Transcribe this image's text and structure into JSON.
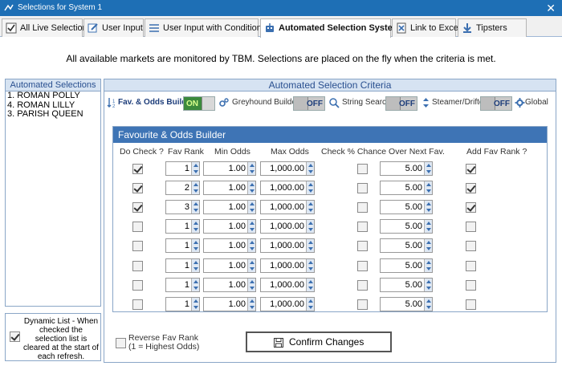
{
  "window": {
    "title": "Selections for System 1",
    "close_glyph": "✕"
  },
  "tabs": [
    {
      "label": "All Live Selections",
      "icon": "checkbox-icon"
    },
    {
      "label": "User Input",
      "icon": "edit-icon"
    },
    {
      "label": "User Input with Conditions",
      "icon": "list-icon"
    },
    {
      "label": "Automated Selection Systems",
      "icon": "robot-icon",
      "active": true
    },
    {
      "label": "Link to Excel",
      "icon": "excel-icon"
    },
    {
      "label": "Tipsters",
      "icon": "download-icon"
    }
  ],
  "banner": "All available markets are monitored by TBM. Selections are placed on the fly when the criteria is met.",
  "left_panel": {
    "title": "Automated Selections",
    "items": [
      "1. ROMAN POLLY",
      "4. ROMAN LILLY",
      "3. PARISH QUEEN"
    ]
  },
  "dynamic_list": {
    "label": "Dynamic List - When checked the selection list is cleared at the start of each refresh.",
    "checked": true
  },
  "criteria": {
    "title": "Automated Selection Criteria",
    "toolbar": [
      {
        "label": "Fav. & Odds Builder",
        "state": "ON"
      },
      {
        "label": "Greyhound Builder",
        "state": "OFF"
      },
      {
        "label": "String Search",
        "state": "OFF"
      },
      {
        "label": "Steamer/Drifter",
        "state": "OFF"
      },
      {
        "label": "Global"
      }
    ]
  },
  "builder": {
    "title": "Favourite & Odds Builder",
    "columns": {
      "do_check": "Do Check ?",
      "fav_rank": "Fav Rank",
      "min_odds": "Min Odds",
      "max_odds": "Max Odds",
      "check_pct": "Check % Chance Over Next Fav.",
      "add_fav_rank": "Add Fav Rank ?"
    },
    "rows": [
      {
        "do_check": true,
        "fav_rank": "1",
        "min_odds": "1.00",
        "max_odds": "1,000.00",
        "check_pct": false,
        "pct": "5.00",
        "add_fav_rank": true
      },
      {
        "do_check": true,
        "fav_rank": "2",
        "min_odds": "1.00",
        "max_odds": "1,000.00",
        "check_pct": false,
        "pct": "5.00",
        "add_fav_rank": true
      },
      {
        "do_check": true,
        "fav_rank": "3",
        "min_odds": "1.00",
        "max_odds": "1,000.00",
        "check_pct": false,
        "pct": "5.00",
        "add_fav_rank": true
      },
      {
        "do_check": false,
        "fav_rank": "1",
        "min_odds": "1.00",
        "max_odds": "1,000.00",
        "check_pct": false,
        "pct": "5.00",
        "add_fav_rank": false
      },
      {
        "do_check": false,
        "fav_rank": "1",
        "min_odds": "1.00",
        "max_odds": "1,000.00",
        "check_pct": false,
        "pct": "5.00",
        "add_fav_rank": false
      },
      {
        "do_check": false,
        "fav_rank": "1",
        "min_odds": "1.00",
        "max_odds": "1,000.00",
        "check_pct": false,
        "pct": "5.00",
        "add_fav_rank": false
      },
      {
        "do_check": false,
        "fav_rank": "1",
        "min_odds": "1.00",
        "max_odds": "1,000.00",
        "check_pct": false,
        "pct": "5.00",
        "add_fav_rank": false
      },
      {
        "do_check": false,
        "fav_rank": "1",
        "min_odds": "1.00",
        "max_odds": "1,000.00",
        "check_pct": false,
        "pct": "5.00",
        "add_fav_rank": false
      }
    ]
  },
  "reverse_fav": {
    "line1": "Reverse Fav Rank",
    "line2": "(1 = Highest Odds)",
    "checked": false
  },
  "confirm_label": "Confirm Changes",
  "colors": {
    "titlebar": "#1e6fb5",
    "panel_header_text": "#2a5090",
    "builder_header": "#3e74b5",
    "toggle_on": "#3c8a3c"
  }
}
